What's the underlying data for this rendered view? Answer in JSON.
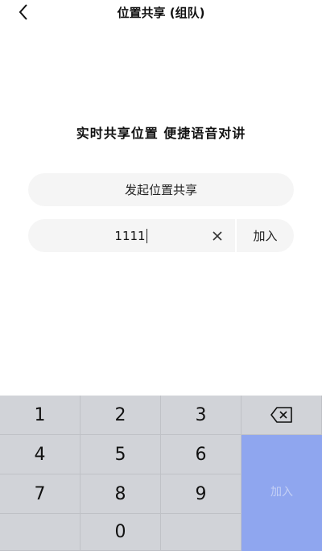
{
  "header": {
    "title": "位置共享 (组队)",
    "back_icon": "chevron-left-icon"
  },
  "main": {
    "slogan": "实时共享位置  便捷语音对讲",
    "start_label": "发起位置共享",
    "code_value": "1111",
    "clear_icon": "close-icon",
    "join_label": "加入"
  },
  "keypad": {
    "keys": [
      "1",
      "2",
      "3",
      "4",
      "5",
      "6",
      "7",
      "8",
      "9",
      "0"
    ],
    "delete_icon": "backspace-icon",
    "submit_label": "加入",
    "submit_color": "#8fa6ef"
  }
}
